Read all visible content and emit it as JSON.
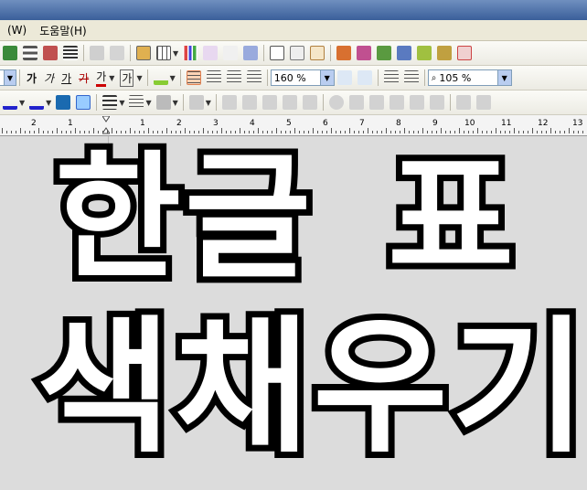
{
  "menu": {
    "items": [
      "(W)",
      "도움말(H)"
    ]
  },
  "toolbar2": {
    "font_buttons": [
      "가",
      "가",
      "가",
      "가",
      "가",
      "가"
    ],
    "line_spacing": "160 %",
    "zoom": "105 %"
  },
  "ruler": {
    "numbers": [
      "2",
      "1",
      "",
      "1",
      "2",
      "3",
      "4",
      "5",
      "6",
      "7",
      "8",
      "9",
      "10",
      "11",
      "12",
      "13"
    ]
  },
  "document": {
    "line1_word1": "한글",
    "line1_word2": "표",
    "line2": "색채우기"
  },
  "colors": {
    "title_bar": "#4a6ea8",
    "menu_bg": "#ece9d8",
    "doc_bg": "#dcdcdc",
    "text_fill": "#ffffff",
    "text_stroke": "#000000"
  }
}
